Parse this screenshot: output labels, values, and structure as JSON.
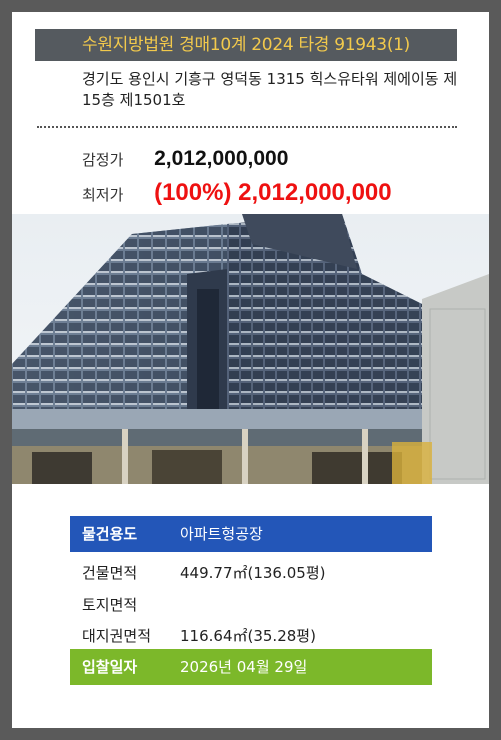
{
  "case_title": "수원지방법원 경매10계 2024 타경 91943(1)",
  "address": "경기도 용인시 기흥구 영덕동 1315 힉스유타워 제에이동 제15층 제1501호",
  "appraisal": {
    "label": "감정가",
    "value": "2,012,000,000"
  },
  "minimum_price": {
    "label": "최저가",
    "value": "(100%) 2,012,000,000"
  },
  "photo": {
    "icon": "building-photo"
  },
  "details": [
    {
      "key": "물건용도",
      "value": "아파트형공장"
    },
    {
      "key": "건물면적",
      "value": "449.77㎡(136.05평)"
    },
    {
      "key": "토지면적",
      "value": ""
    },
    {
      "key": "대지권면적",
      "value": "116.64㎡(35.28평)"
    },
    {
      "key": "입찰일자",
      "value": "2026년 04월 29일"
    }
  ],
  "colors": {
    "banner_bg": "#555a5f",
    "banner_text": "#f2c94c",
    "minimum_price": "#ee1111",
    "usage_row": "#2356b8",
    "bid_date_row": "#7cb82a"
  }
}
